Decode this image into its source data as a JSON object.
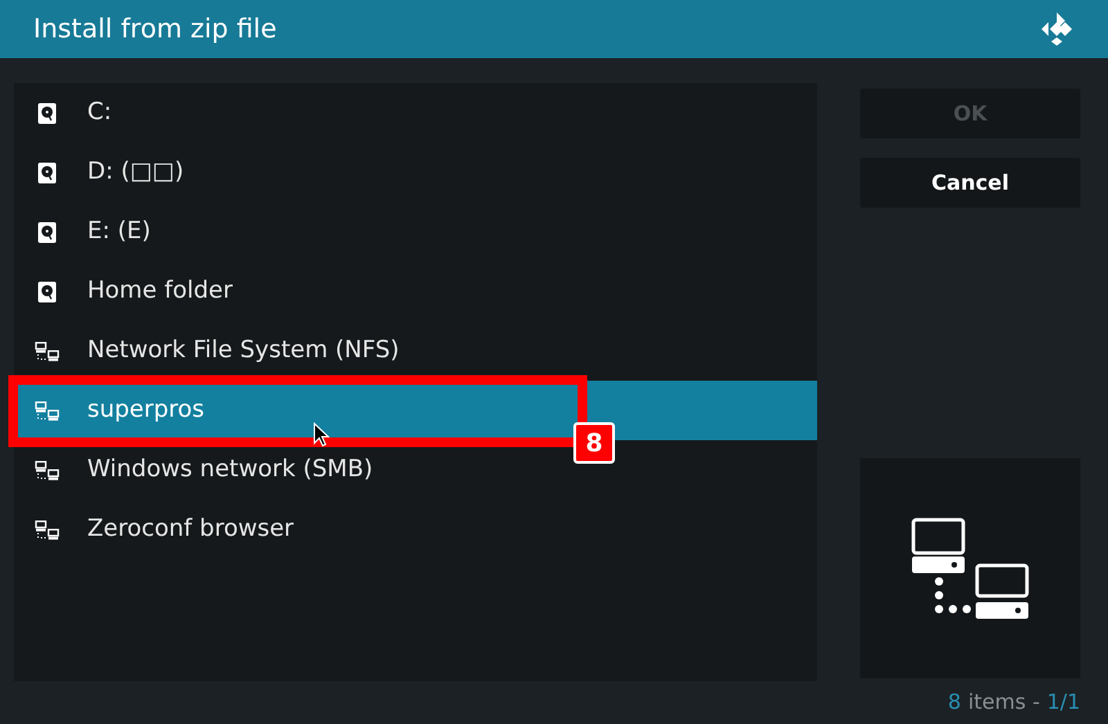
{
  "window": {
    "title": "Install from zip file"
  },
  "sources": [
    {
      "label": "C:",
      "kind": "drive",
      "selected": false
    },
    {
      "label": "D: (□□)",
      "kind": "drive",
      "selected": false
    },
    {
      "label": "E: (E)",
      "kind": "drive",
      "selected": false
    },
    {
      "label": "Home folder",
      "kind": "drive",
      "selected": false
    },
    {
      "label": "Network File System (NFS)",
      "kind": "network",
      "selected": false
    },
    {
      "label": "superpros",
      "kind": "network",
      "selected": true
    },
    {
      "label": "Windows network (SMB)",
      "kind": "network",
      "selected": false
    },
    {
      "label": "Zeroconf browser",
      "kind": "network",
      "selected": false
    }
  ],
  "buttons": [
    {
      "label": "OK",
      "disabled": true
    },
    {
      "label": "Cancel",
      "disabled": false
    }
  ],
  "callout": {
    "label": "8"
  },
  "status_bar": {
    "count": "8",
    "count_label": "items -",
    "page": "1/1"
  }
}
